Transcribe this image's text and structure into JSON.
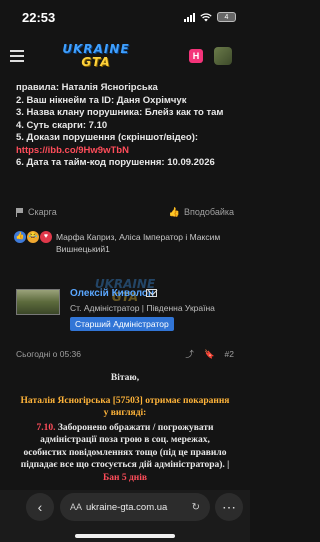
{
  "status": {
    "time": "22:53",
    "battery": "4"
  },
  "header": {
    "logo_top": "UKRAINE",
    "logo_bottom": "GTA",
    "notif_badge": "H"
  },
  "post1": {
    "lines": [
      "правила: Наталія Ясногірська",
      "2. Ваш нікнейм та ID: Даня Охрімчук",
      "3. Назва клану порушника: Блейз как то там",
      "4. Суть скарги: 7.10",
      "5. Докази порушення (скріншот/відео):",
      "6. Дата та тайм-код порушення: 10.09.2026"
    ],
    "link": "https://ibb.co/9Hw9wTbN",
    "report_label": "Скарга",
    "like_label": "Вподобайка"
  },
  "reactions": {
    "text": "Марфа Каприз, Аліса Імператор і Максим Вишнецький1"
  },
  "watermark": {
    "top": "UKRAINE",
    "bottom": "GTA"
  },
  "post2": {
    "author": "Олексій Киволон",
    "role": "Ст. Адміністратор | Південна Україна",
    "badge": "Старший Адміністратор",
    "date": "Сьогодні о 05:36",
    "post_number": "#2",
    "greeting": "Вітаю,",
    "accused_line": "Наталія Ясногірська [57503] отримає покарання у вигляді:",
    "rule_number": "7.10.",
    "rule_text": " Заборонено ображати / погрожувати адміністрації поза грою в соц. мережах, особистих повідомленнях тощо (під це правило підпадає все що стосується дій адміністратора). | ",
    "rule_tail": "Бан 5 днів"
  },
  "browser": {
    "url": "ukraine-gta.com.ua",
    "reader_label": "AA"
  }
}
